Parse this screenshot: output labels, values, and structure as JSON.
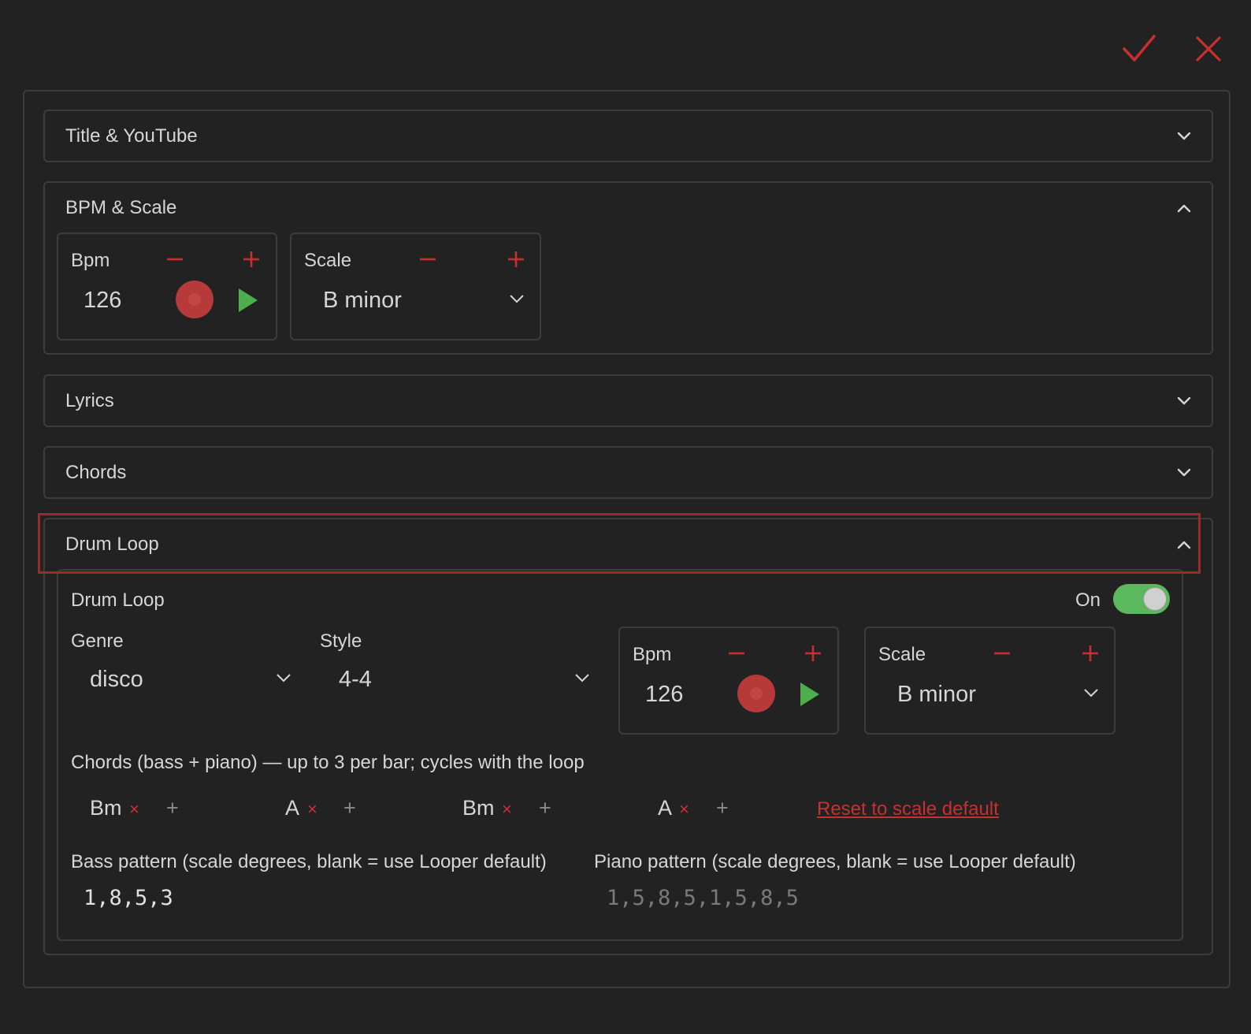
{
  "actions": {
    "confirm": "confirm",
    "close": "close"
  },
  "sections": {
    "title_youtube": "Title & YouTube",
    "bpm_scale": "BPM & Scale",
    "lyrics": "Lyrics",
    "chords": "Chords",
    "drum_loop": "Drum Loop"
  },
  "bpm_scale": {
    "bpm_label": "Bpm",
    "bpm_value": "126",
    "scale_label": "Scale",
    "scale_value": "B minor"
  },
  "drum_loop": {
    "title": "Drum Loop",
    "toggle_label": "On",
    "genre_label": "Genre",
    "genre_value": "disco",
    "style_label": "Style",
    "style_value": "4-4",
    "bpm_label": "Bpm",
    "bpm_value": "126",
    "scale_label": "Scale",
    "scale_value": "B minor",
    "chords_caption": "Chords (bass + piano) — up to 3 per bar; cycles with the loop",
    "chords": [
      "Bm",
      "A",
      "Bm",
      "A"
    ],
    "remove_glyph": "×",
    "add_glyph": "+",
    "reset_label": "Reset to scale default",
    "bass_label": "Bass pattern (scale degrees, blank = use Looper default)",
    "bass_value": "1,8,5,3",
    "piano_label": "Piano pattern (scale degrees, blank = use Looper default)",
    "piano_placeholder": "1,5,8,5,1,5,8,5"
  },
  "colors": {
    "accent_red": "#c83030",
    "accent_green": "#5cb85c",
    "border": "#3c3c3c",
    "background": "#222222"
  }
}
